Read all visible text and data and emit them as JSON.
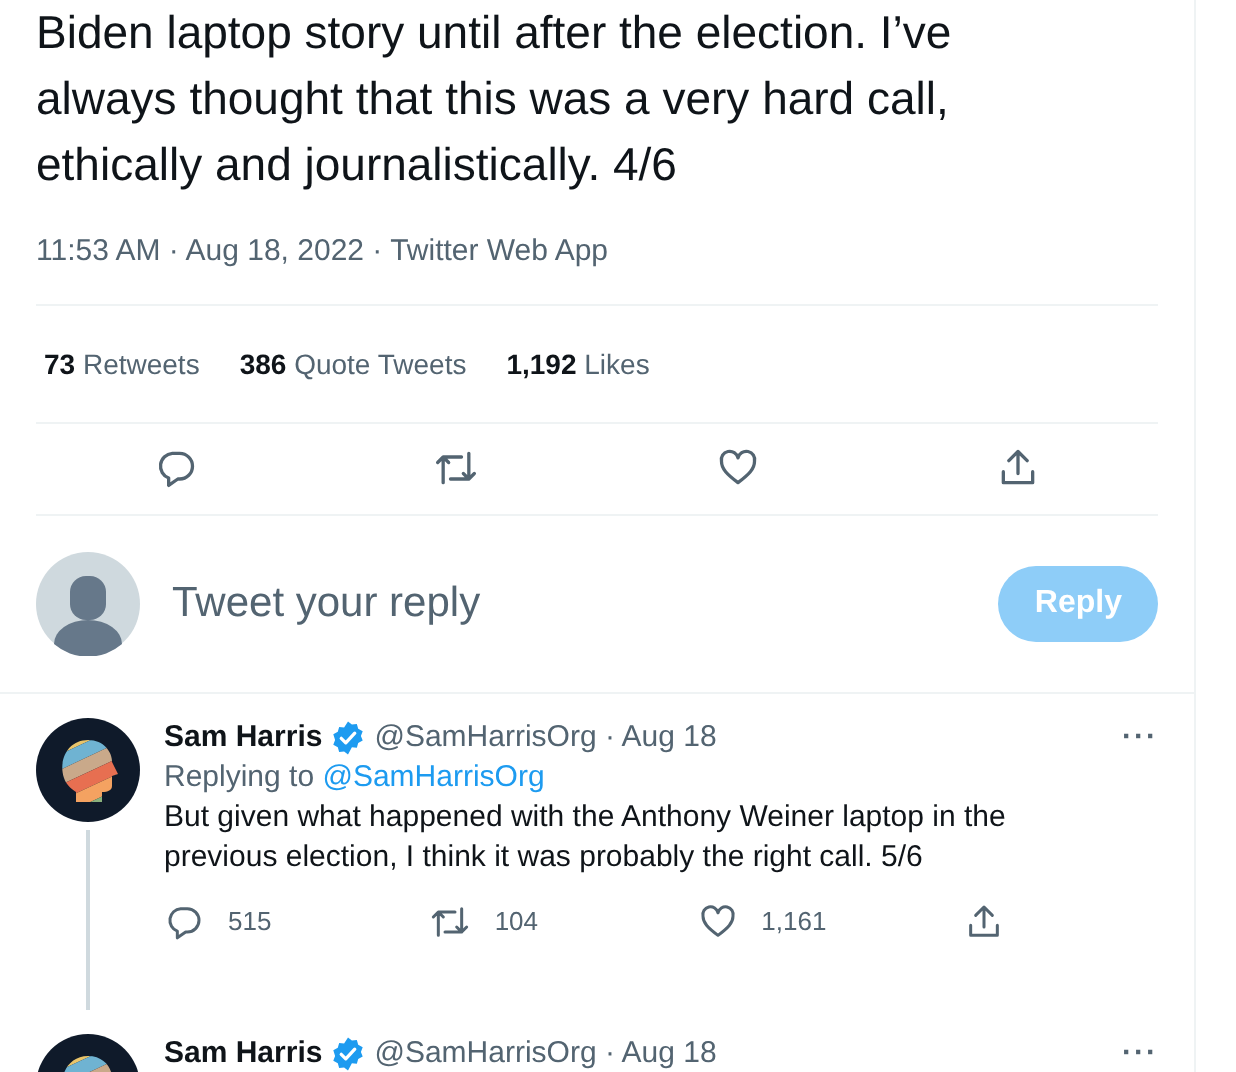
{
  "main_tweet": {
    "text": "Biden laptop story until after the election. I’ve always thought that this was a very hard call, ethically and journalistically. 4/6",
    "meta": "11:53 AM · Aug 18, 2022 · Twitter Web App",
    "stats": [
      {
        "text": "**73** Retweets"
      },
      {
        "text": "**386** Quote Tweets"
      },
      {
        "text": "**1,192** Likes"
      }
    ],
    "actions": [
      {
        "kind": "reply"
      },
      {
        "kind": "retweet"
      },
      {
        "kind": "like"
      },
      {
        "kind": "share"
      }
    ]
  },
  "composer": {
    "placeholder": "Tweet your reply",
    "button": {
      "label": "Reply",
      "disabled": true
    }
  },
  "replies": [
    {
      "name": "Sam Harris",
      "verified": true,
      "handle_date": "@SamHarrisOrg · Aug 18",
      "more": "···",
      "thread_line": true,
      "replying_label": "Replying to",
      "replying_to": "@SamHarrisOrg",
      "text": "But given what happened with the Anthony Weiner laptop in the previous election, I think it was probably the right call. 5/6",
      "actions": [
        {
          "kind": "reply",
          "count": "515"
        },
        {
          "kind": "retweet",
          "count": "104"
        },
        {
          "kind": "like",
          "count": "1,161"
        },
        {
          "kind": "share"
        }
      ]
    },
    {
      "name": "Sam Harris",
      "verified": true,
      "handle_date": "@SamHarrisOrg · Aug 18",
      "more": "···"
    }
  ]
}
